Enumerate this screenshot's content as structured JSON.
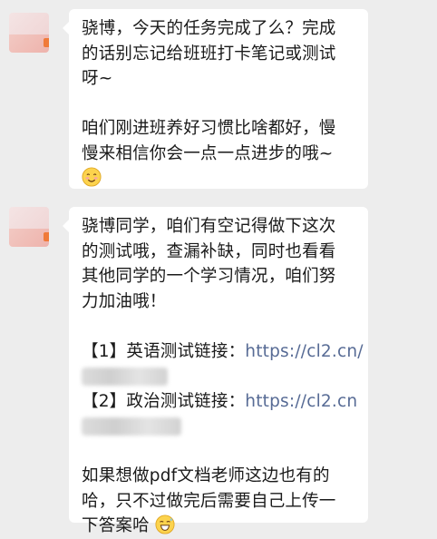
{
  "chat": {
    "messages": [
      {
        "lines": [
          "骁博，今天的任务完成了么？完成",
          "的话别忘记给班班打卡笔记或测试",
          "呀~",
          "",
          "咱们刚进班养好习惯比啥都好，慢",
          "慢来相信你会一点一点进步的哦~"
        ],
        "emoji": "smile-emoji"
      },
      {
        "intro_lines": [
          "骁博同学，咱们有空记得做下这次",
          "的测试哦，查漏补缺，同时也看看",
          "其他同学的一个学习情况，咱们努",
          "力加油哦！"
        ],
        "link1_label": "【1】英语测试链接：",
        "link1_url": "https://cl2.cn/",
        "link2_label": "【2】政治测试链接：",
        "link2_url": "https://cl2.cn",
        "outro_lines": [
          "如果想做pdf文档老师这边也有的",
          "哈，只不过做完后需要自己上传一",
          "下答案哈"
        ],
        "emoji": "grin-sweat-emoji"
      }
    ]
  },
  "colors": {
    "background": "#ededed",
    "bubble": "#ffffff",
    "link": "#576b95",
    "avatar_accent": "#f07a3a"
  }
}
